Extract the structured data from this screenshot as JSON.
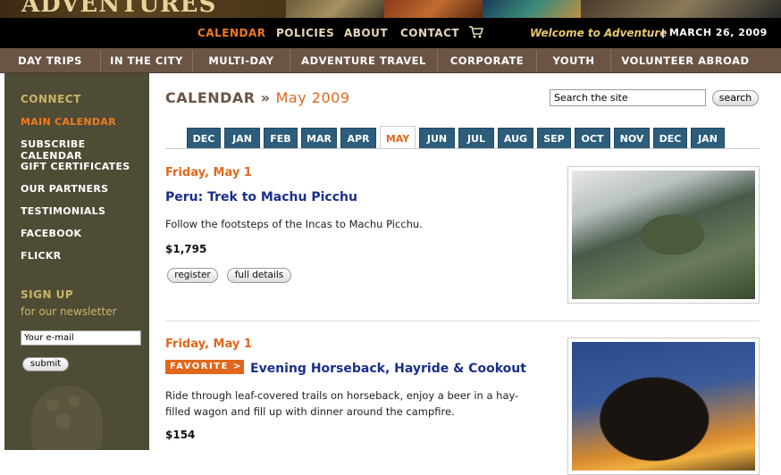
{
  "brand": {
    "logo_text": "ADVENTURES"
  },
  "topnav": {
    "items": [
      "CALENDAR",
      "POLICIES",
      "ABOUT",
      "CONTACT"
    ],
    "active": "CALENDAR",
    "welcome": "Welcome to Adventure",
    "date": "|  MARCH 26, 2009"
  },
  "subnav": {
    "items": [
      "DAY TRIPS",
      "IN THE CITY",
      "MULTI-DAY",
      "ADVENTURE TRAVEL",
      "CORPORATE",
      "YOUTH",
      "VOLUNTEER ABROAD"
    ]
  },
  "sidebar": {
    "connect_heading": "CONNECT",
    "links": [
      "MAIN CALENDAR",
      "SUBSCRIBE CALENDAR",
      "GIFT CERTIFICATES",
      "OUR PARTNERS",
      "TESTIMONIALS",
      "FACEBOOK",
      "FLICKR"
    ],
    "active_link": "MAIN CALENDAR",
    "signup_heading": "SIGN UP",
    "signup_sub": "for our newsletter",
    "email_placeholder": "Your e-mail",
    "submit_label": "submit"
  },
  "main": {
    "title": "CALENDAR",
    "title_sep": "»",
    "month": "May 2009",
    "search_placeholder": "Search the site",
    "search_label": "search",
    "month_tabs": [
      "DEC",
      "JAN",
      "FEB",
      "MAR",
      "APR",
      "MAY",
      "JUN",
      "JUL",
      "AUG",
      "SEP",
      "OCT",
      "NOV",
      "DEC",
      "JAN"
    ],
    "active_tab": "MAY"
  },
  "events": [
    {
      "date": "Friday, May 1",
      "title": "Peru: Trek to Machu Picchu",
      "description": "Follow the footsteps of the Incas to Machu Picchu.",
      "price": "$1,795",
      "register_label": "register",
      "details_label": "full details",
      "favorite": false
    },
    {
      "date": "Friday, May 1",
      "title": "Evening Horseback, Hayride & Cookout",
      "description": "Ride through leaf-covered trails on horseback, enjoy a beer in a hay-filled wagon and fill up with dinner around the campfire.",
      "price": "$154",
      "favorite": true,
      "favorite_label": "FAVORITE  >"
    }
  ],
  "colors": {
    "accent_orange": "#e0671c",
    "tab_blue": "#2d5d7b",
    "sidebar_olive": "#4f4c35",
    "subnav_brown": "#6b5445",
    "link_blue": "#1a2f8a"
  }
}
